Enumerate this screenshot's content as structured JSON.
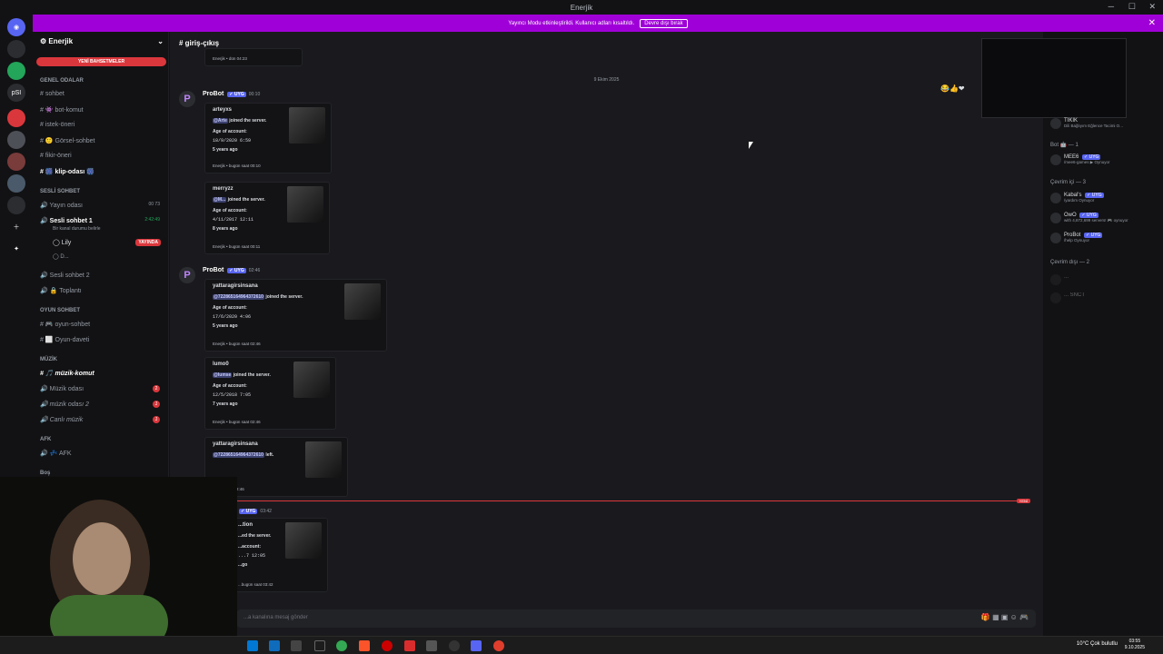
{
  "window": {
    "title": "Enerjik"
  },
  "banner": {
    "text": "Yayıncı Modu etkinleştirildi. Kullanıcı adları kısaltıldı.",
    "button": "Devre dışı bırak"
  },
  "server": {
    "name": "Enerjik",
    "new_topics": "YENİ BAHSETMELER"
  },
  "channels": {
    "genel_cat": "GENEL ODALAR",
    "genel": [
      "sohbet",
      "👾 bot-komut",
      "istek-öneri",
      "🙂 Görsel-sohbet",
      "fikir-öneri",
      "🎆 klip-odası 🎆"
    ],
    "sesli_cat": "SESLİ SOHBET",
    "yayin_odasi": "Yayın odası",
    "yayin_counts": "00  73",
    "sesli1": "Sesli sohbet 1",
    "sesli1_timer": "2:42:49",
    "sesli1_status": "Bir kanal durumu belirle",
    "users": [
      "Lily",
      "D..."
    ],
    "live_badge": "YAYINDA",
    "sesli2": "Sesli sohbet 2",
    "toplanti": "🔒 Toplantı",
    "oyun_cat": "OYUN SOHBET",
    "oyun": [
      "🎮 oyun-sohbet",
      "⬜ Oyun-daveti"
    ],
    "muzik_cat": "MÜZİK",
    "muzik_komut": "🎵 müzik-komut",
    "muzik": [
      "Müzik odası",
      "müzik odası 2",
      "Canlı müzik"
    ],
    "muzik_counts": [
      "2",
      "1",
      "1"
    ],
    "afk_cat": "AFK",
    "afk": "💤 AFK",
    "bos_cat": "Boş"
  },
  "chat": {
    "channel_name": "giriş-çıkış",
    "top_footer": "Enerjik • dün 04:23",
    "date_divider": "9 Ekim 2025",
    "author": "ProBot",
    "bot_tag": "✓ UYG",
    "times": [
      "00:10",
      "02:46",
      "03:42"
    ],
    "age_label": "Age of account:",
    "embeds": [
      {
        "user": "arteyxs",
        "mention": "@Arte",
        "text": "joined the server.",
        "date": "18/9/2020 6:59",
        "years": "5 years ago",
        "footer": "Enerjik • bugün saat 00:10"
      },
      {
        "user": "merryzz",
        "mention": "@M...",
        "text": "joined the server.",
        "date": "4/11/2017 12:11",
        "years": "8 years ago",
        "footer": "Enerjik • bugün saat 00:11"
      },
      {
        "user": "yattaragirsinsana",
        "mention": "@722865164964372610",
        "text": "joined the server.",
        "date": "17/6/2020 4:06",
        "years": "5 years ago",
        "footer": "Enerjik • bugün saat 02:46"
      },
      {
        "user": "lumo0",
        "mention": "@lumse",
        "text": "joined the server.",
        "date": "12/5/2018 7:05",
        "years": "7 years ago",
        "footer": "Enerjik • bugün saat 02:46"
      },
      {
        "user": "yattaragirsinsana",
        "mention": "@722865164964372610",
        "text": "left.",
        "footer": "bugün saat 02:46"
      },
      {
        "user": "...tion",
        "text": "...ed the server.",
        "aa": "...account:",
        "date": "...7 12:05",
        "years": "...go",
        "footer": "...bugün saat 03:42"
      }
    ],
    "new_tag": "YENİ"
  },
  "input": {
    "placeholder": "...a kanalına mesaj gönder"
  },
  "members": {
    "top": {
      "name": "TIKIK",
      "status": "Dili Bağlıyım Eğlence Tacimi O..."
    },
    "bot_section": "Bot 🤖 — 1",
    "bot": {
      "name": "MEE6",
      "status": "/mee6-games ▶ Oynuyor"
    },
    "online_section": "Çevrim içi — 3",
    "online": [
      {
        "name": "Kabal's",
        "status": "/yardım Oynuyor"
      },
      {
        "name": "OwO",
        "status": "with 4,872,699 servers! 🎮 oynuyor"
      },
      {
        "name": "ProBot",
        "status": "/help Oynuyor"
      }
    ],
    "offline_section": "Çevrim dışı — 2",
    "offline": [
      "...",
      "...  SNCT"
    ]
  },
  "taskbar": {
    "weather": "10°C  Çok bulutlu",
    "time": "03:55",
    "date": "9.10.2025"
  }
}
